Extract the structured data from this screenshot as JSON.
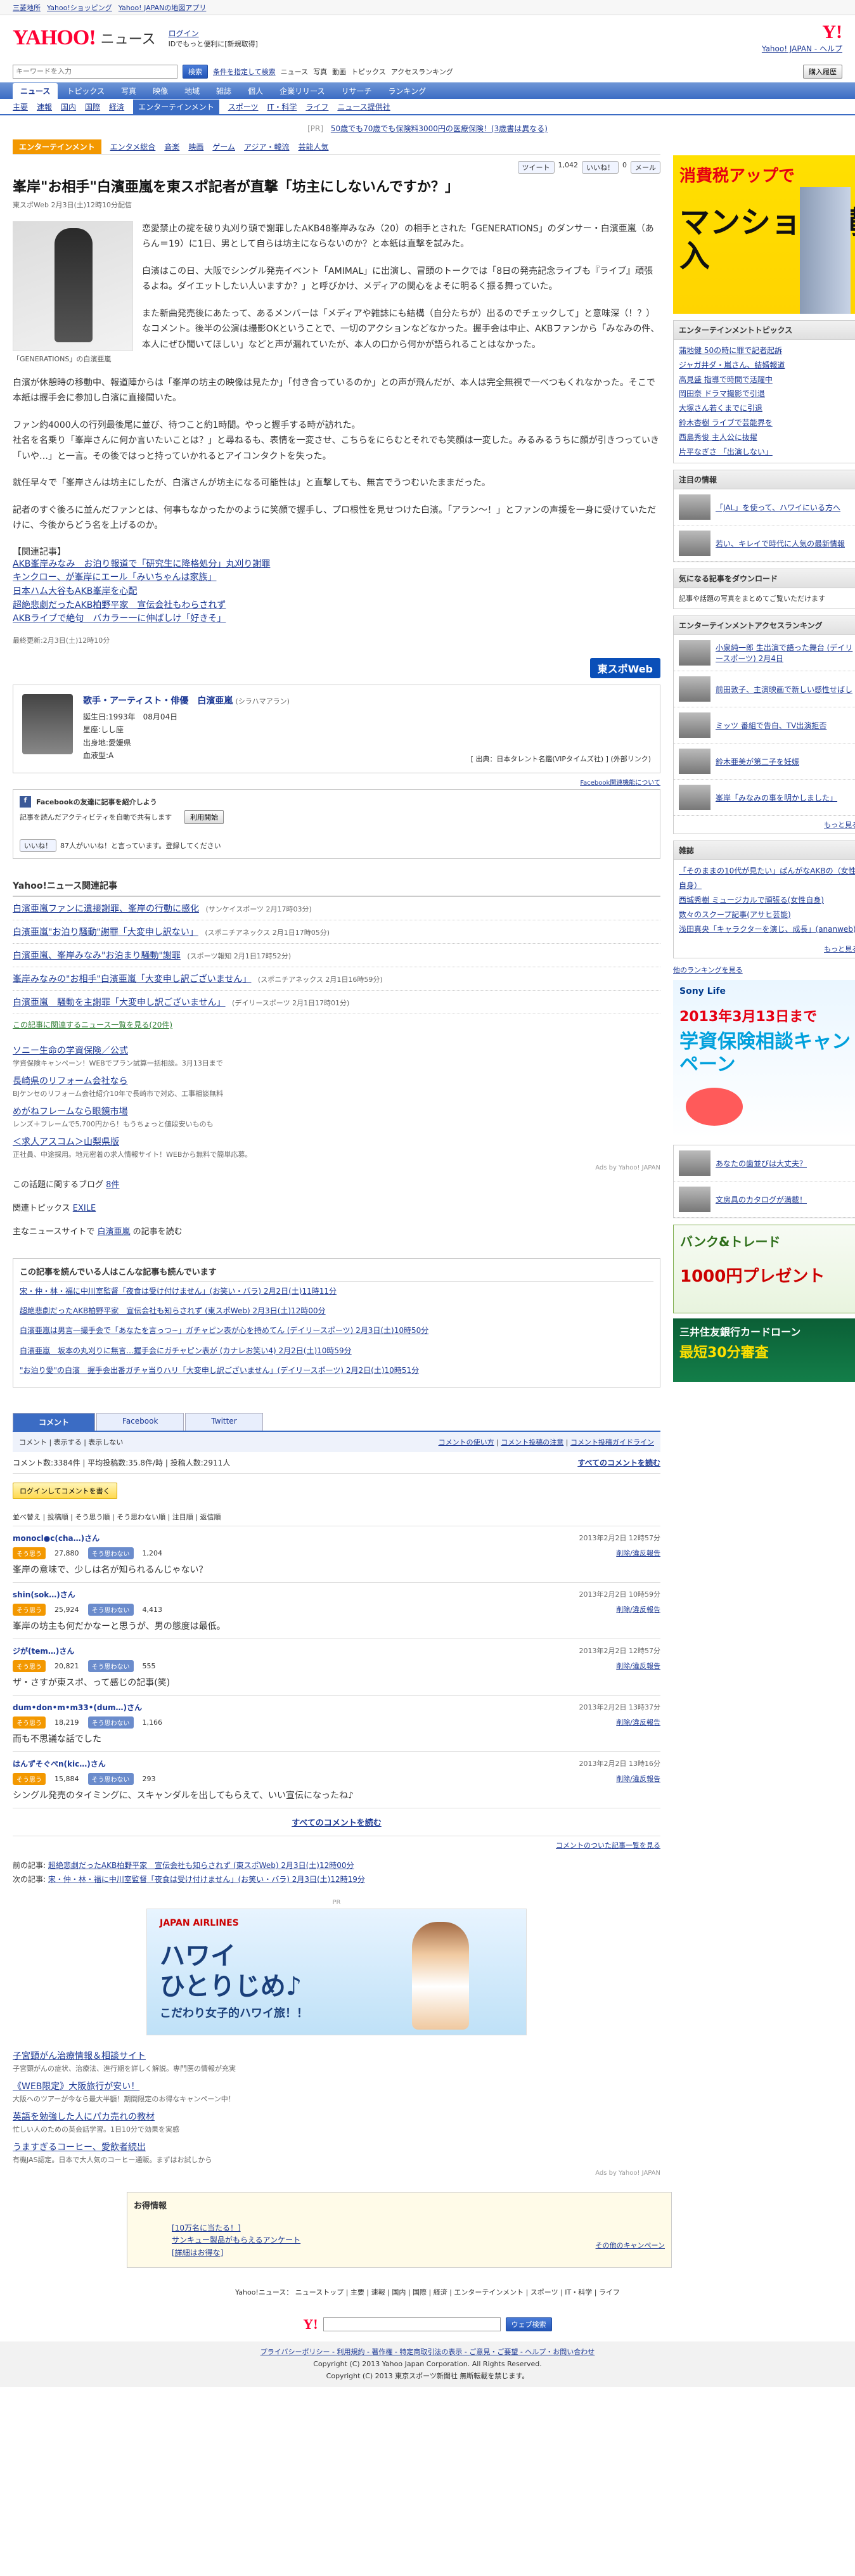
{
  "topbar": {
    "links": [
      "三菱地所",
      "Yahoo!ショッピング",
      "Yahoo! JAPANの地図アプリ"
    ]
  },
  "header": {
    "logo": "YAHOO!",
    "logo_sub": "ニュース",
    "login": "ログイン",
    "login_sub": "IDでもっと便利に[新規取得]",
    "right_link": "Yahoo! JAPAN - ヘルプ",
    "yj": "Y!"
  },
  "search": {
    "placeholder": "キーワードを入力",
    "search_btn": "検索",
    "option1": "条件を指定して検索",
    "option2": "ニュース",
    "option3": "写真",
    "option4": "動画",
    "option5": "トピックス",
    "option6": "アクセスランキング",
    "subscribe_btn": "購入履歴"
  },
  "nav": {
    "items": [
      "ニュース",
      "トピックス",
      "写真",
      "映像",
      "地域",
      "雑誌",
      "個人",
      "企業リリース",
      "リサーチ",
      "ランキング"
    ]
  },
  "subnav": {
    "items": [
      "主要",
      "速報",
      "国内",
      "国際",
      "経済",
      "エンターテインメント",
      "スポーツ",
      "IT・科学",
      "ライフ",
      "ニュース提供社"
    ]
  },
  "pr_banner": {
    "label": "[PR]",
    "text": "50歳でも70歳でも保険料3000円の医療保険！(3歳書は異なる)"
  },
  "category": {
    "label": "エンターテインメント",
    "items": [
      "エンタメ総合",
      "音楽",
      "映画",
      "ゲーム",
      "アジア・韓流",
      "芸能人気"
    ]
  },
  "social": {
    "tweet": "ツイート",
    "tweet_count": "1,042",
    "like": "いいね！",
    "like_count": "0",
    "mail": "メール"
  },
  "article": {
    "title": "峯岸\"お相手\"白濱亜嵐を東スポ記者が直撃「坊主にしないんですか？」",
    "meta": "東スポWeb 2月3日(土)12時10分配信",
    "photo_caption": "「GENERATIONS」の白濱亜嵐",
    "lead": "恋愛禁止の掟を破り丸刈り頭で謝罪したAKB48峯岸みなみ（20）の相手とされた「GENERATIONS」のダンサー・白濱亜嵐（あらん＝19）に1日、男として自らは坊主にならないのか？と本紙は直撃を試みた。",
    "p1": "白濱はこの日、大阪でシングル発売イベント「AMIMAL」に出演し、冒頭のトークでは「8日の発売記念ライブも『ライブ』頑張るよね。ダイエットしたい人いますか？」と呼びかけ、メディアの関心をよそに明るく振る舞っていた。",
    "p2": "また新曲発売後にあたって、あるメンバーは「メディアや雑誌にも結構（自分たちが）出るのでチェックして」と意味深（！？）なコメント。後半の公演は撮影OKということで、一切のアクションなどなかった。握手会は中止、AKBファンから「みなみの件、本人にぜひ聞いてほしい」などと声が漏れていたが、本人の口から何かが語られることはなかった。",
    "p3": "白濱が休憩時の移動中、報道陣からは「峯岸の坊主の映像は見たか」「付き合っているのか」との声が飛んだが、本人は完全無視で一べつもくれなかった。そこで本紙は握手会に参加し白濱に直接聞いた。",
    "p4": "ファン約4000人の行列最後尾に並び、待つこと約1時間。やっと握手する時が訪れた。\n社名を名乗り「峯岸さんに何か言いたいことは？」と尋ねるも、表情を一変させ、こちらをにらむとそれでも笑顔は一変した。みるみるうちに顔が引きつっていき「いや…」と一言。その後ではっと持っていかれるとアイコンタクトを失った。",
    "p5": "就任早々で「峯岸さんは坊主にしたが、白濱さんが坊主になる可能性は」と直撃しても、無言でうつむいたままだった。",
    "p6": "記者のすぐ後ろに並んだファンとは、何事もなかったかのように笑顔で握手し、プロ根性を見せつけた白濱。「アラン～！」とファンの声援を一身に受けていただけに、今後からどう名を上げるのか。"
  },
  "related": {
    "title": "【関連記事】",
    "links": [
      "AKB峯岸みなみ　お泊り報道で「研究生に降格処分」丸刈り謝罪",
      "キンクロー、が峯岸にエール「みいちゃんは家族」",
      "日本ハム大谷もAKB峯岸を心配",
      "超絶悲劇だったAKB柏野平家　宣伝会社もわらされず",
      "AKBライブで絶句　バカラー一に伸ばしけ「好きそ」"
    ],
    "updated": "最終更新:2月3日(土)12時10分"
  },
  "source": {
    "name": "東スポWeb"
  },
  "profile": {
    "heading": "歌手・アーティスト・俳優　白濱亜嵐",
    "reading": "(シラハマアラン)",
    "dob": "誕生日:1993年　08月04日",
    "blood": "星座:しし座",
    "from": "出身地:愛媛県",
    "type": "血液型:A",
    "credit": "[ 出典：日本タレント名鑑(VIPタイムズ社) ] (外部リンク)"
  },
  "facebook": {
    "about": "Facebook関連機能について",
    "title": "Facebookの友達に記事を紹介しよう",
    "desc": "記事を読んだアクティビティを自動で共有します",
    "button": "利用開始",
    "like": "いいね！",
    "like_desc": "87人がいいね！と言っています。登録してください"
  },
  "related_news": {
    "heading": "Yahoo!ニュース関連記事",
    "items": [
      {
        "title": "白濱亜嵐ファンに遺接謝罪、峯岸の行動に感化",
        "source": "(サンケイスポーツ 2月17時03分)"
      },
      {
        "title": "白濱亜嵐\"お泊り騒動\"謝罪「大変申し訳ない」",
        "source": "(スポニチアネックス 2月1日17時05分)"
      },
      {
        "title": "白濱亜嵐、峯岸みなみ\"お泊まり騒動\"謝罪",
        "source": "(スポーツ報知 2月1日17時52分)"
      },
      {
        "title": "峯岸みなみの\"お相手\"白濱亜嵐「大変申し訳ございません」",
        "source": "(スポニチアネックス 2月1日16時59分)"
      },
      {
        "title": "白濱亜嵐　騒動を主謝罪「大変申し訳ございません」",
        "source": "(デイリースポーツ 2月1日17時01分)"
      }
    ],
    "more": "この記事に関連するニュース一覧を見る(20件)"
  },
  "ads": {
    "items": [
      {
        "title": "ソニー生命の学資保険／公式",
        "desc": "学資保険キャンペーン！WEBでプラン試算一括相談。3月13日まで"
      },
      {
        "title": "長崎県のリフォーム会社なら",
        "desc": "BJケンセのリフォーム会社紹介10年で長崎市で対応、工事相談無料"
      },
      {
        "title": "めがねフレームなら眼鏡市場",
        "desc": "レンズ＋フレームで5,700円から！もうちょっと値段安いものも"
      },
      {
        "title": "＜求人アスコム＞山梨県版",
        "desc": "正社員、中途採用。地元密着の求人情報サイト！WEBから無料で簡単応募。"
      }
    ],
    "adsby": "Ads by Yahoo! JAPAN"
  },
  "blogs": {
    "label": "この話題に関するブログ",
    "count": "8件",
    "topics_label": "関連トピックス",
    "topics": "EXILE",
    "main_label": "主なニュースサイトで",
    "main_topic": "白濱亜嵐",
    "main_suffix": "の記事を読む"
  },
  "also_read": {
    "heading": "この記事を読んでいる人はこんな記事も読んでいます",
    "items": [
      "宋・仲・林・福に中川室監督「夜食は受け付けません」(お笑い・バラ) 2月2日(土)11時11分",
      "超絶悲劇だったAKB柏野平家　宣伝会社も知らされず (東スポWeb) 2月3日(土)12時00分",
      "白濱亜嵐は男言一撮手会で「あなたを言っつ~」ガチャピン表が心を持めてん (デイリースポーツ) 2月3日(土)10時50分",
      "白濱亜嵐　坂本の丸刈りに無言…握手会にガチャピン表が (カナレお笑い4) 2月2日(土)10時59分",
      "\"お泊り愛\"の白濱　握手会出番ガチャ当りハリ「大変申し訳ございません」(デイリースポーツ) 2月2日(土)10時51分"
    ]
  },
  "comments": {
    "tabs": [
      "コメント",
      "Facebook",
      "Twitter"
    ],
    "filter": "コメント | 表示する | 表示しない",
    "policy1": "コメントの使い方",
    "policy2": "コメント投稿の注意",
    "policy3": "コメント投稿ガイドライン",
    "count_label": "コメント数:3384件 | 平均投稿数:35.8件/時 | 投稿人数:2911人",
    "all_link": "すべてのコメントを読む",
    "login_btn": "ログインしてコメントを書く",
    "sort": "並べ替え | 投稿順 | そう思う順 | そう思わない順 | 注目順 | 返信順",
    "up_label": "そう思う",
    "down_label": "そう思わない",
    "report": "削除/違反報告",
    "list": [
      {
        "user": "monocl●c(cha…)さん",
        "date": "2013年2月2日 12時57分",
        "up": "27,880",
        "down": "1,204",
        "text": "峯岸の意味で、少しは名が知られるんじゃない？"
      },
      {
        "user": "shin(sok…)さん",
        "date": "2013年2月2日 10時59分",
        "up": "25,924",
        "down": "4,413",
        "text": "峯岸の坊主も何だかなーと思うが、男の態度は最低。"
      },
      {
        "user": "ジが(tem…)さん",
        "date": "2013年2月2日 12時57分",
        "up": "20,821",
        "down": "555",
        "text": "ザ・さすが東スポ、って感じの記事(笑)"
      },
      {
        "user": "dum•don•m•m33•(dum…)さん",
        "date": "2013年2月2日 13時37分",
        "up": "18,219",
        "down": "1,166",
        "text": "而も不思議な話でした"
      },
      {
        "user": "はんずそぐぺn(kic…)さん",
        "date": "2013年2月2日 13時16分",
        "up": "15,884",
        "down": "293",
        "text": "シングル発売のタイミングに、スキャンダルを出してもらえて、いい宣伝になったね♪"
      }
    ],
    "read_all": "すべてのコメントを読む",
    "list_link": "コメントのついた記事一覧を見る"
  },
  "prevnext": {
    "prev_label": "前の記事:",
    "prev": "超絶悲劇だったAKB柏野平家　宣伝会社も知らされず (東スポWeb) 2月3日(土)12時00分",
    "next_label": "次の記事:",
    "next": "宋・仲・林・福に中川室監督「夜食は受け付けません」(お笑い・バラ) 2月3日(土)12時19分"
  },
  "jal_ad": {
    "pr": "PR",
    "brand": "JAPAN AIRLINES",
    "copy1": "ハワイ",
    "copy2": "ひとりじめ♪",
    "sub": "こだわり女子的ハワイ旅！！"
  },
  "bottom_ads": {
    "items": [
      {
        "title": "子宮頸がん治療情報＆相談サイト",
        "desc": "子宮頸がんの症状、治療法、進行期を詳しく解説。専門医の情報が充実"
      },
      {
        "title": "《WEB限定》大阪旅行が安い！",
        "desc": "大阪へのツアーが今なら最大半額！期間限定のお得なキャンペーン中！"
      },
      {
        "title": "英語を勉強した人にパカ売れの教材",
        "desc": "忙しい人のための英会話学習。1日10分で効果を実感"
      },
      {
        "title": "うますぎるコーヒー、愛飲者続出",
        "desc": "有機JAS認定。日本で大人気のコーヒー通販。まずはお試しから"
      }
    ],
    "adsby": "Ads by Yahoo! JAPAN"
  },
  "otoku": {
    "heading": "お得情報",
    "items": [
      "[10万名に当たる！]",
      "サンキュー製品がもらえるアンケート",
      "[詳細はお得な]"
    ],
    "more": "その他のキャンペーン"
  },
  "footer": {
    "nav": "Yahoo!ニュース： ニューストップ | 主要 | 速報 | 国内 | 国際 | 経済 | エンターテインメント | スポーツ | IT・科学 | ライフ",
    "search_btn": "ウェブ検索",
    "links": "プライバシーポリシー - 利用規約 - 著作権 - 特定商取引法の表示 - ご意見・ご要望 - ヘルプ・お問い合わせ",
    "copyright1": "Copyright (C) 2013 Yahoo Japan Corporation. All Rights Reserved.",
    "copyright2": "Copyright (C) 2013 東京スポーツ新聞社 無断転載を禁じます。"
  },
  "sidebar": {
    "pr": "PR",
    "tax_ad1": "消費税アップで",
    "tax_ad2": "マンション購入",
    "entertainment_topics": "エンターテインメントトピックス",
    "topics": [
      "蒲地健 50の時に罪で記者起訴",
      "ジャガ井ダ・嵐さん、結婚報道",
      "高見盛 指導で時間で活躍中",
      "岡田奈 ドラマ撮影で引退",
      "大塚さん若くまでに引退",
      "鈴木杏樹 ライブで芸能界を",
      "西島秀俊 主人公に抜擢",
      "片平なぎさ 「出演しない」"
    ],
    "attention_h": "注目の情報",
    "attention": [
      "「JAL」を使って、ハワイにいる方へ",
      "若い、キレイで時代に人気の最新情報"
    ],
    "article_h": "気になる記事をダウンロード",
    "article_desc": "記事や話題の写真をまとめてご覧いただけます",
    "access_h": "エンターテインメントアクセスランキング",
    "ranking": [
      "小泉純一郎 生出演で語った舞台 (デイリースポーツ) 2月4日",
      "前田敦子、主演映画で新しい感性せばし",
      "ミッツ 番組で告白、TV出演拒否",
      "鈴木亜美が第二子を妊娠",
      "峯岸「みなみの事を明かしました」"
    ],
    "more": "もっと見る",
    "magazine_h": "雑誌",
    "magazine": [
      "「そのままの10代が見たい」ぱんがなAKBの（女性自身）",
      "西城秀樹 ミュージカルで頑張る(女性自身)",
      "数々のスクープ記事(アサヒ芸能)",
      "浅田真央「キャラクターを演じ、成長」(ananweb)"
    ],
    "ranking_link": "他のランキングを見る",
    "sony_ad1": "Sony Life",
    "sony_ad2": "2013年3月13日まで",
    "sony_ad3": "学資保険相談キャンペーン",
    "attention2": [
      "あなたの歯並びは大丈夫？",
      "文房具のカタログが満載！"
    ],
    "bank_ad1": "バンク&トレード",
    "bank_ad2": "1000円プレゼント",
    "card_ad1": "三井住友銀行カードローン",
    "card_ad2": "最短30分審査"
  }
}
